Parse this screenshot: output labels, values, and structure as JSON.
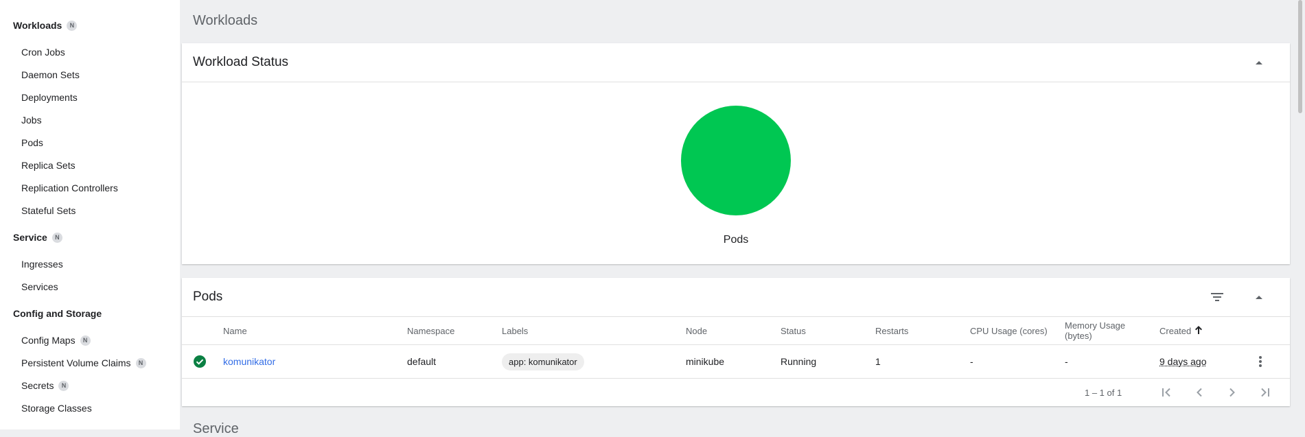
{
  "sidebar": {
    "sections": [
      {
        "label": "Workloads",
        "badge": "N"
      },
      {
        "label": "Service",
        "badge": "N"
      },
      {
        "label": "Config and Storage"
      }
    ],
    "workloads_items": [
      "Cron Jobs",
      "Daemon Sets",
      "Deployments",
      "Jobs",
      "Pods",
      "Replica Sets",
      "Replication Controllers",
      "Stateful Sets"
    ],
    "service_items": [
      "Ingresses",
      "Services"
    ],
    "config_items": [
      {
        "label": "Config Maps",
        "badge": "N"
      },
      {
        "label": "Persistent Volume Claims",
        "badge": "N"
      },
      {
        "label": "Secrets",
        "badge": "N"
      },
      {
        "label": "Storage Classes"
      }
    ]
  },
  "main": {
    "title": "Workloads",
    "next_section_title": "Service"
  },
  "workload_status": {
    "title": "Workload Status",
    "chart_label": "Pods",
    "collapse_icon": "arrow-drop-up-icon",
    "chart_color": "#00c752"
  },
  "pods": {
    "title": "Pods",
    "filter_icon": "filter-icon",
    "collapse_icon": "arrow-drop-up-icon",
    "columns": [
      "Name",
      "Namespace",
      "Labels",
      "Node",
      "Status",
      "Restarts",
      "CPU Usage (cores)",
      "Memory Usage",
      "(bytes)",
      "Created"
    ],
    "rows": [
      {
        "status_icon": "check-circle-icon",
        "name": "komunikator",
        "namespace": "default",
        "label": "app: komunikator",
        "node": "minikube",
        "status": "Running",
        "restarts": "1",
        "cpu": "-",
        "memory": "-",
        "created": "9 days ago"
      }
    ],
    "pagination": "1 – 1 of 1"
  },
  "colors": {
    "accent": "#326de6",
    "success": "#00c752",
    "status_ok": "#0b8043"
  }
}
